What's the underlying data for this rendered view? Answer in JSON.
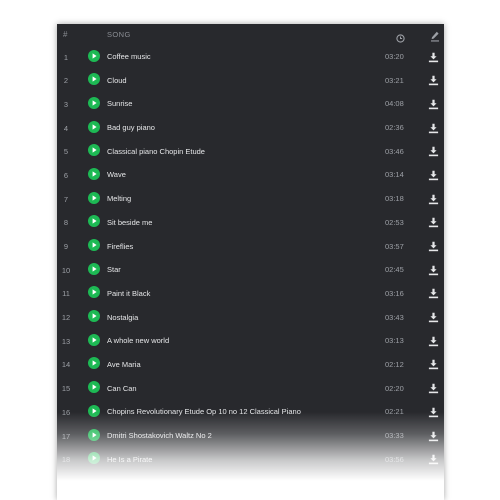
{
  "header": {
    "num_label": "#",
    "song_label": "SONG",
    "duration_icon": "clock-icon",
    "action_icon": "edit-icon"
  },
  "colors": {
    "panel_bg": "#28292d",
    "accent": "#1db954",
    "text": "#e6e7e9",
    "muted": "#9da0a6"
  },
  "songs": [
    {
      "num": "1",
      "title": "Coffee music",
      "duration": "03:20"
    },
    {
      "num": "2",
      "title": "Cloud",
      "duration": "03:21"
    },
    {
      "num": "3",
      "title": "Sunrise",
      "duration": "04:08"
    },
    {
      "num": "4",
      "title": "Bad guy piano",
      "duration": "02:36"
    },
    {
      "num": "5",
      "title": "Classical piano Chopin Etude",
      "duration": "03:46"
    },
    {
      "num": "6",
      "title": "Wave",
      "duration": "03:14"
    },
    {
      "num": "7",
      "title": "Melting",
      "duration": "03:18"
    },
    {
      "num": "8",
      "title": "Sit beside me",
      "duration": "02:53"
    },
    {
      "num": "9",
      "title": "Fireflies",
      "duration": "03:57"
    },
    {
      "num": "10",
      "title": "Star",
      "duration": "02:45"
    },
    {
      "num": "11",
      "title": "Paint it Black",
      "duration": "03:16"
    },
    {
      "num": "12",
      "title": "Nostalgia",
      "duration": "03:43"
    },
    {
      "num": "13",
      "title": "A whole new world",
      "duration": "03:13"
    },
    {
      "num": "14",
      "title": "Ave Maria",
      "duration": "02:12"
    },
    {
      "num": "15",
      "title": "Can Can",
      "duration": "02:20"
    },
    {
      "num": "16",
      "title": "Chopins Revolutionary Etude Op 10 no 12 Classical Piano",
      "duration": "02:21"
    },
    {
      "num": "17",
      "title": "Dmitri Shostakovich Waltz No 2",
      "duration": "03:33"
    },
    {
      "num": "18",
      "title": "He Is a Pirate",
      "duration": "03:56"
    }
  ]
}
